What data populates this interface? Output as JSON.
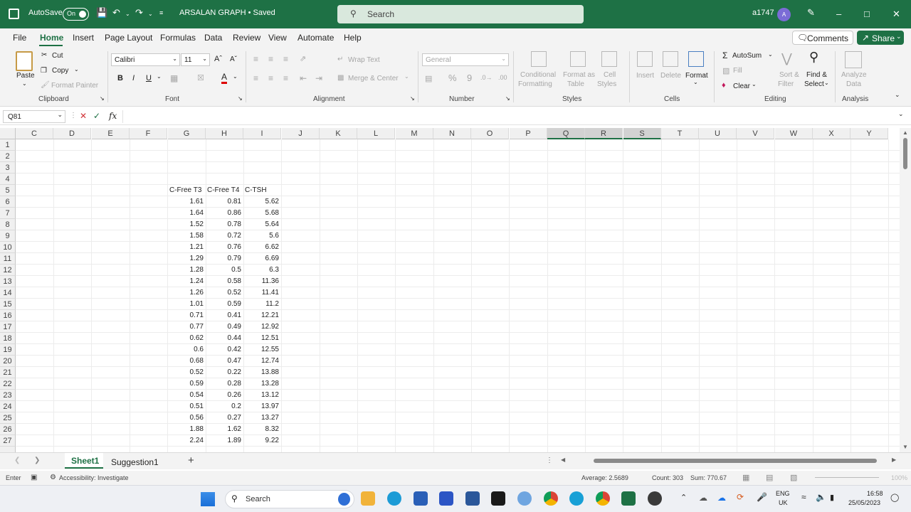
{
  "titlebar": {
    "autosave_label": "AutoSave",
    "toggle_label": "On",
    "doc_title": "ARSALAN GRAPH • Saved",
    "search_placeholder": "Search",
    "user": "a1747",
    "avatar_initial": "A"
  },
  "menu": {
    "items": [
      "File",
      "Home",
      "Insert",
      "Page Layout",
      "Formulas",
      "Data",
      "Review",
      "View",
      "Automate",
      "Help"
    ],
    "comments": "Comments",
    "share": "Share"
  },
  "ribbon": {
    "clipboard": {
      "paste": "Paste",
      "cut": "Cut",
      "copy": "Copy",
      "format_painter": "Format Painter",
      "group": "Clipboard"
    },
    "font": {
      "name": "Calibri",
      "size": "11",
      "bold": "B",
      "italic": "I",
      "underline": "U",
      "group": "Font"
    },
    "alignment": {
      "wrap_text": "Wrap Text",
      "merge_center": "Merge & Center",
      "group": "Alignment"
    },
    "number": {
      "format": "General",
      "group": "Number"
    },
    "styles": {
      "conditional_1": "Conditional",
      "conditional_2": "Formatting",
      "format_as_1": "Format as",
      "format_as_2": "Table",
      "cell_styles_1": "Cell",
      "cell_styles_2": "Styles",
      "group": "Styles"
    },
    "cells": {
      "insert": "Insert",
      "delete": "Delete",
      "format": "Format",
      "group": "Cells"
    },
    "editing": {
      "autosum": "AutoSum",
      "fill": "Fill",
      "clear": "Clear",
      "sort_1": "Sort &",
      "sort_2": "Filter",
      "find_1": "Find &",
      "find_2": "Select",
      "group": "Editing"
    },
    "analysis": {
      "analyze_1": "Analyze",
      "analyze_2": "Data",
      "group": "Analysis"
    }
  },
  "formula_bar": {
    "name_box": "Q81",
    "fx": "fx",
    "content": ""
  },
  "columns": [
    "C",
    "D",
    "E",
    "F",
    "G",
    "H",
    "I",
    "J",
    "K",
    "L",
    "M",
    "N",
    "O",
    "P",
    "Q",
    "R",
    "S",
    "T",
    "U",
    "V",
    "W",
    "X",
    "Y"
  ],
  "rows": [
    "1",
    "2",
    "3",
    "4",
    "5",
    "6",
    "7",
    "8",
    "9",
    "10",
    "11",
    "12",
    "13",
    "14",
    "15",
    "16",
    "17",
    "18",
    "19",
    "20",
    "21",
    "22",
    "23",
    "24",
    "25",
    "26",
    "27"
  ],
  "table": {
    "headers": [
      "C-Free T3",
      "C-Free T4",
      "C-TSH"
    ],
    "data": [
      [
        "1.61",
        "0.81",
        "5.62"
      ],
      [
        "1.64",
        "0.86",
        "5.68"
      ],
      [
        "1.52",
        "0.78",
        "5.64"
      ],
      [
        "1.58",
        "0.72",
        "5.6"
      ],
      [
        "1.21",
        "0.76",
        "6.62"
      ],
      [
        "1.29",
        "0.79",
        "6.69"
      ],
      [
        "1.28",
        "0.5",
        "6.3"
      ],
      [
        "1.24",
        "0.58",
        "11.36"
      ],
      [
        "1.26",
        "0.52",
        "11.41"
      ],
      [
        "1.01",
        "0.59",
        "11.2"
      ],
      [
        "0.71",
        "0.41",
        "12.21"
      ],
      [
        "0.77",
        "0.49",
        "12.92"
      ],
      [
        "0.62",
        "0.44",
        "12.51"
      ],
      [
        "0.6",
        "0.42",
        "12.55"
      ],
      [
        "0.68",
        "0.47",
        "12.74"
      ],
      [
        "0.52",
        "0.22",
        "13.88"
      ],
      [
        "0.59",
        "0.28",
        "13.28"
      ],
      [
        "0.54",
        "0.26",
        "13.12"
      ],
      [
        "0.51",
        "0.2",
        "13.97"
      ],
      [
        "0.56",
        "0.27",
        "13.27"
      ],
      [
        "1.88",
        "1.62",
        "8.32"
      ],
      [
        "2.24",
        "1.89",
        "9.22"
      ]
    ]
  },
  "sheets": {
    "active": "Sheet1",
    "other": "Suggestion1",
    "add": "+"
  },
  "status": {
    "mode": "Enter",
    "accessibility": "Accessibility: Investigate",
    "average": "Average: 2.5689",
    "count": "Count: 303",
    "sum": "Sum: 770.67",
    "zoom": "100%"
  },
  "taskbar": {
    "search": "Search",
    "lang_1": "ENG",
    "lang_2": "UK",
    "time": "16:58",
    "date": "25/05/2023"
  }
}
